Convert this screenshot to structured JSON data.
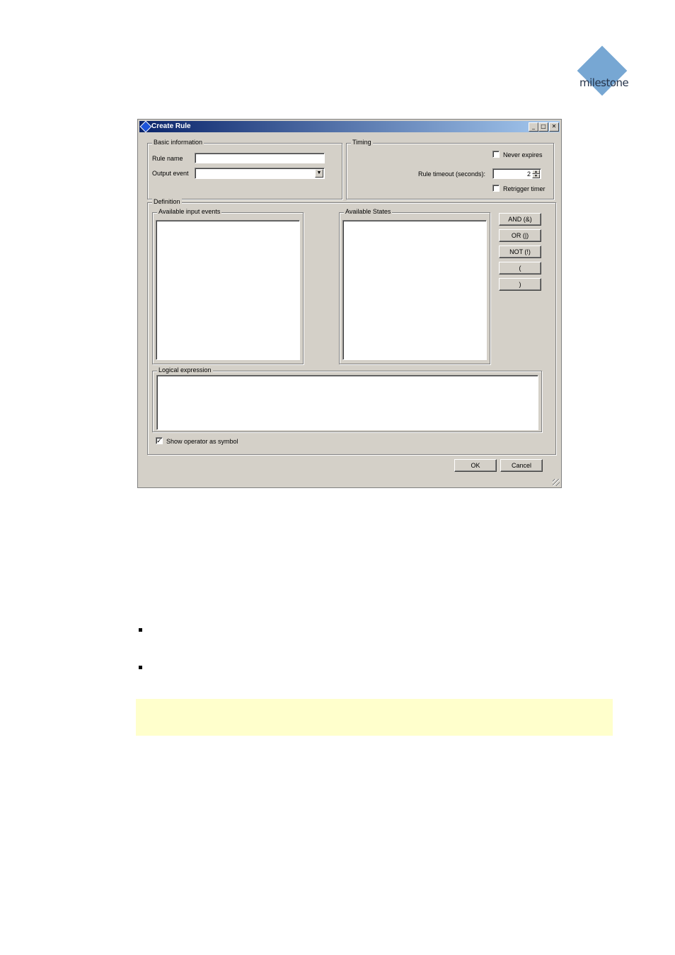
{
  "logo": {
    "text": "milestone",
    "color": "#77a7d3"
  },
  "dialog": {
    "title": "Create Rule",
    "titlebar_buttons": [
      "_",
      "□",
      "✕"
    ],
    "basic_info": {
      "legend": "Basic information",
      "rule_name_label": "Rule name",
      "rule_name_value": "",
      "output_event_label": "Output event",
      "output_event_value": ""
    },
    "timing": {
      "legend": "Timing",
      "never_expires_label": "Never expires",
      "never_expires_checked": false,
      "rule_timeout_label": "Rule timeout (seconds):",
      "rule_timeout_value": "2",
      "retrigger_label": "Retrigger timer",
      "retrigger_checked": false
    },
    "definition": {
      "legend": "Definition",
      "available_input_events_label": "Available input events",
      "available_states_label": "Available States",
      "operators": [
        "AND (&)",
        "OR (|)",
        "NOT (!)",
        "(",
        ")"
      ],
      "logical_expression_label": "Logical expression",
      "show_operator_label": "Show operator as symbol",
      "show_operator_checked": true
    },
    "ok_label": "OK",
    "cancel_label": "Cancel"
  },
  "note_color": "#ffffcc"
}
